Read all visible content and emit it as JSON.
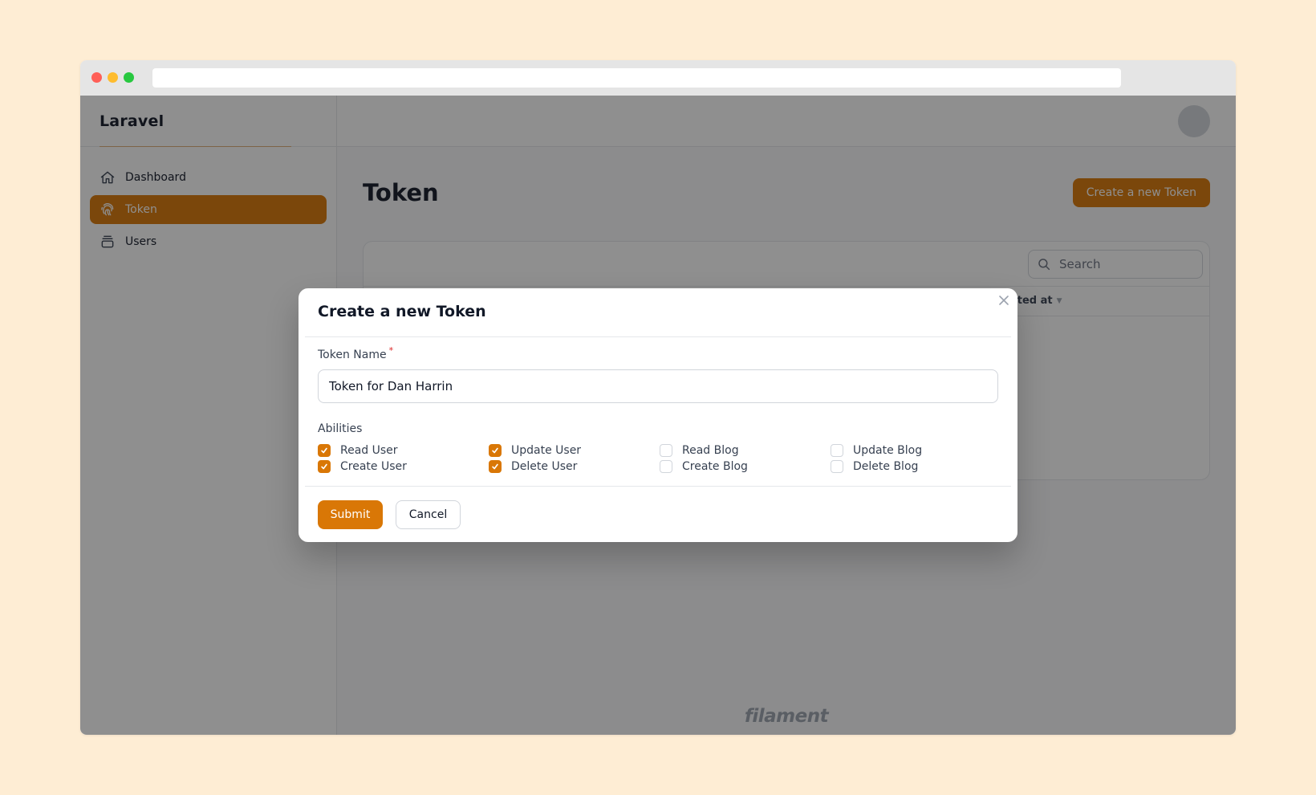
{
  "colors": {
    "page_bg": "#feedd4",
    "accent": "#d97706",
    "overlay": "rgba(17,17,17,0.47)"
  },
  "browser": {
    "url": ""
  },
  "sidebar": {
    "brand": "Laravel",
    "items": [
      {
        "label": "Dashboard",
        "icon": "home-icon",
        "active": false
      },
      {
        "label": "Token",
        "icon": "fingerprint-icon",
        "active": true
      },
      {
        "label": "Users",
        "icon": "collection-icon",
        "active": false
      }
    ]
  },
  "header": {
    "avatar_icon": "avatar"
  },
  "main": {
    "title": "Token",
    "create_button": "Create a new Token",
    "search": {
      "placeholder": "Search",
      "icon": "search-icon"
    },
    "table": {
      "visible_column_header": "ated at"
    },
    "watermark": "filament"
  },
  "modal": {
    "title": "Create a new Token",
    "close_icon": "close-icon",
    "token_name": {
      "label": "Token Name",
      "required_mark": "*",
      "value": "Token for Dan Harrin"
    },
    "abilities": {
      "label": "Abilities",
      "options": [
        {
          "label": "Read User",
          "checked": true
        },
        {
          "label": "Update User",
          "checked": true
        },
        {
          "label": "Read Blog",
          "checked": false
        },
        {
          "label": "Update Blog",
          "checked": false
        },
        {
          "label": "Create User",
          "checked": true
        },
        {
          "label": "Delete User",
          "checked": true
        },
        {
          "label": "Create Blog",
          "checked": false
        },
        {
          "label": "Delete Blog",
          "checked": false
        }
      ]
    },
    "submit_label": "Submit",
    "cancel_label": "Cancel"
  }
}
